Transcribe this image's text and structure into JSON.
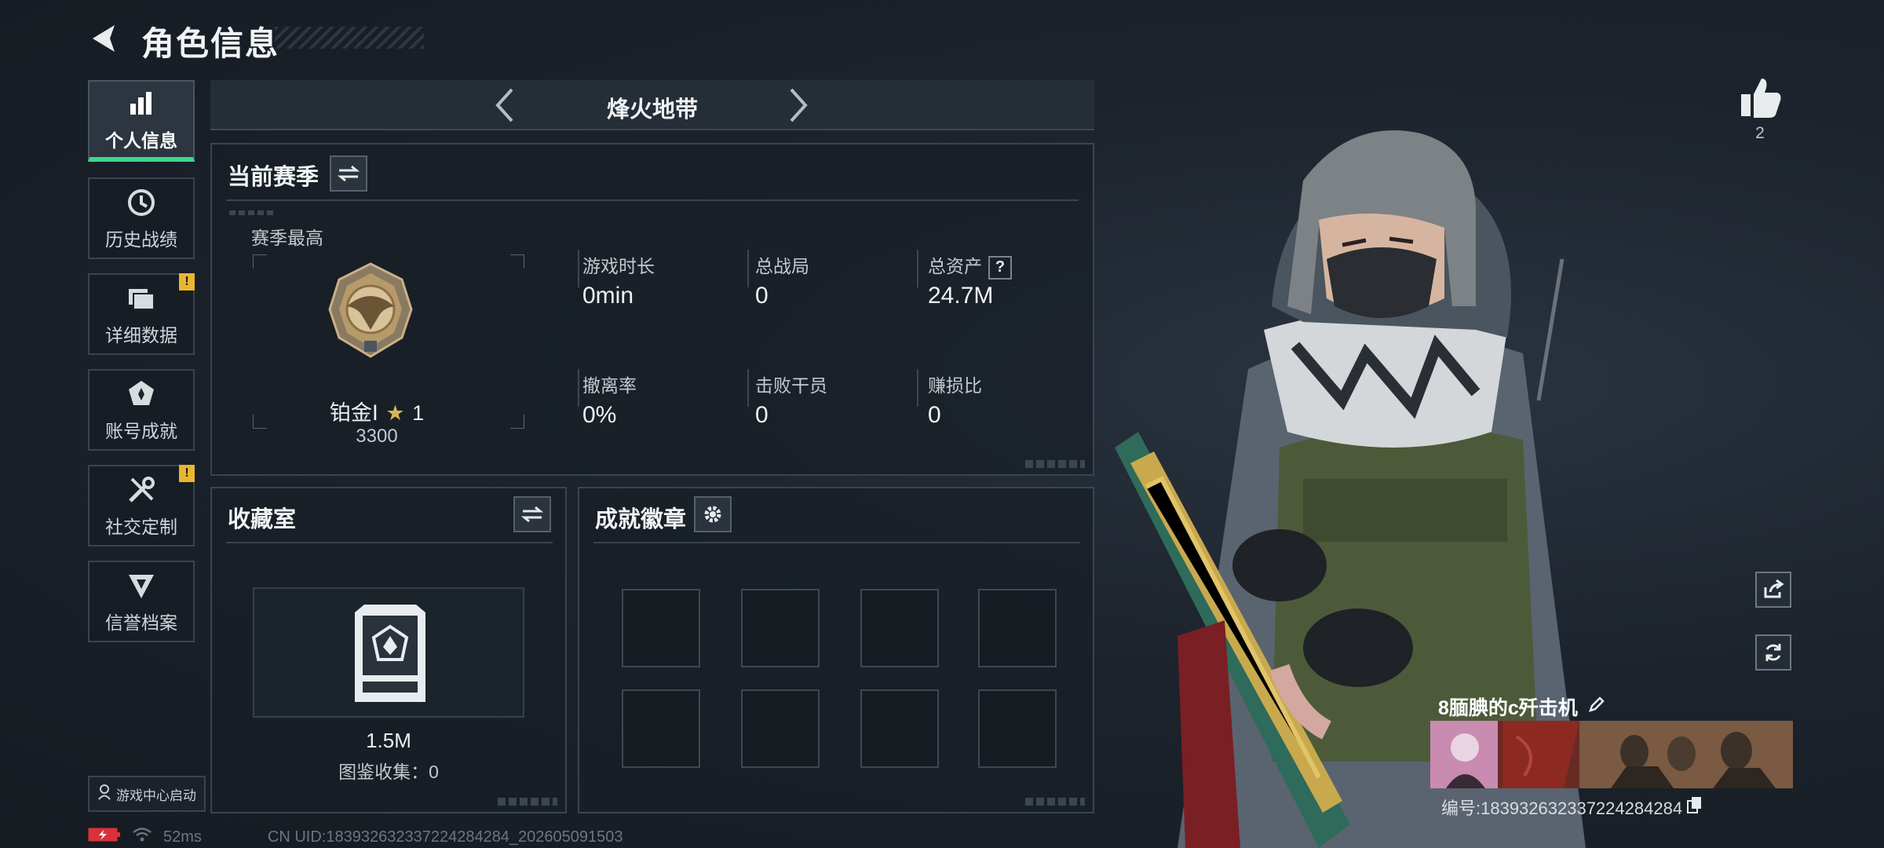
{
  "header": {
    "title": "角色信息"
  },
  "sidebar": {
    "items": [
      {
        "label": "个人信息",
        "icon": "bar-chart-icon",
        "active": true,
        "warning": ""
      },
      {
        "label": "历史战绩",
        "icon": "clock-history-icon",
        "active": false,
        "warning": ""
      },
      {
        "label": "详细数据",
        "icon": "folders-icon",
        "active": false,
        "warning": "!"
      },
      {
        "label": "账号成就",
        "icon": "achievement-icon",
        "active": false,
        "warning": ""
      },
      {
        "label": "社交定制",
        "icon": "tools-icon",
        "active": false,
        "warning": "!"
      },
      {
        "label": "信誉档案",
        "icon": "reputation-icon",
        "active": false,
        "warning": ""
      }
    ],
    "launch_button": "游戏中心启动"
  },
  "status_bar": {
    "ping": "52ms",
    "uid_line": "CN UID:1839326323372242842​84_202605091503"
  },
  "mode": {
    "title": "烽火地带"
  },
  "season": {
    "title": "当前赛季",
    "best_label": "赛季最高",
    "rank_name": "铂金Ⅰ",
    "rank_stars": "1",
    "rank_points": "3300",
    "stats": [
      {
        "label": "游戏时长",
        "value": "0min",
        "help": false
      },
      {
        "label": "总战局",
        "value": "0",
        "help": false
      },
      {
        "label": "总资产",
        "value": "24.7M",
        "help": true
      },
      {
        "label": "撤离率",
        "value": "0%",
        "help": false
      },
      {
        "label": "击败干员",
        "value": "0",
        "help": false
      },
      {
        "label": "赚损比",
        "value": "0",
        "help": false
      }
    ],
    "help_glyph": "?"
  },
  "collection": {
    "title": "收藏室",
    "value": "1.5M",
    "catalog_label": "图鉴收集：0"
  },
  "achievements": {
    "title": "成就徽章",
    "slots": 8
  },
  "profile": {
    "likes": "2",
    "player_name": "8腼腆的c歼击机",
    "player_id": "编号:1839326323372242842​84"
  },
  "colors": {
    "accent": "#3fd68a",
    "warning": "#e8b730",
    "panel_border": "#3a4450",
    "background": "#1c232c"
  }
}
